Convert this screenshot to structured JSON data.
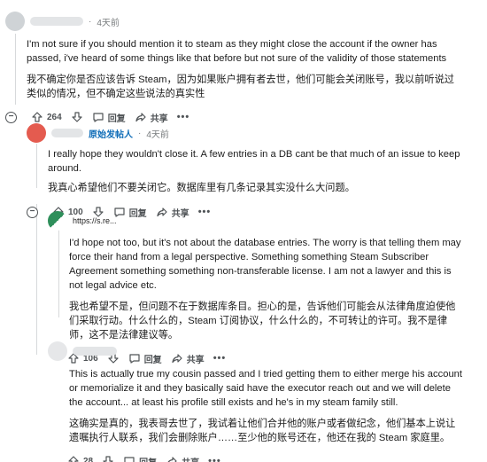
{
  "c1": {
    "time": "4天前",
    "en": "I'm not sure if you should mention it to steam as they might close the account if the owner has passed, i've heard of some things like that before but not sure of the validity of those statements",
    "zh": "我不确定你是否应该告诉 Steam，因为如果账户拥有者去世，他们可能会关闭账号，我以前听说过类似的情况，但不确定这些说法的真实性",
    "votes": "264",
    "reply": "回复",
    "share": "共享",
    "more": "•••",
    "collapse": "−"
  },
  "c2": {
    "op_label": "原始发帖人",
    "time": "4天前",
    "en": "I really hope they wouldn't close it. A few entries in a DB cant be that much of an issue to keep around.",
    "zh": "我真心希望他们不要关闭它。数据库里有几条记录其实没什么大问题。",
    "votes": "100",
    "reply": "回复",
    "share": "共享",
    "more": "•••",
    "collapse": "−"
  },
  "c3": {
    "link_text": "https://s.re...",
    "en": "I'd hope not too, but it's not about the database entries. The worry is that telling them may force their hand from a legal perspective. Something something Steam Subscriber Agreement something something non-transferable license. I am not a lawyer and this is not legal advice etc.",
    "zh": "我也希望不是，但问题不在于数据库条目。担心的是，告诉他们可能会从法律角度迫使他们采取行动。什么什么的，Steam 订阅协议，什么什么的，不可转让的许可。我不是律师，这不是法律建议等。",
    "votes": "106",
    "reply": "回复",
    "share": "共享",
    "more": "•••"
  },
  "c4": {
    "en": "This is actually true my cousin passed and I tried getting them to either merge his account or memorialize it and they basically said have the executor reach out and we will delete the account... at least his profile still exists and he's in my steam family still.",
    "zh": "这确实是真的，我表哥去世了，我试着让他们合并他的账户或者做纪念，他们基本上说让遗嘱执行人联系，我们会删除账户……至少他的账号还在，他还在我的 Steam 家庭里。",
    "votes": "28",
    "reply": "回复",
    "share": "共享",
    "more": "•••"
  },
  "icons": [
    "upvote-icon",
    "downvote-icon",
    "reply-icon",
    "share-icon",
    "collapse-icon",
    "more-icon"
  ]
}
